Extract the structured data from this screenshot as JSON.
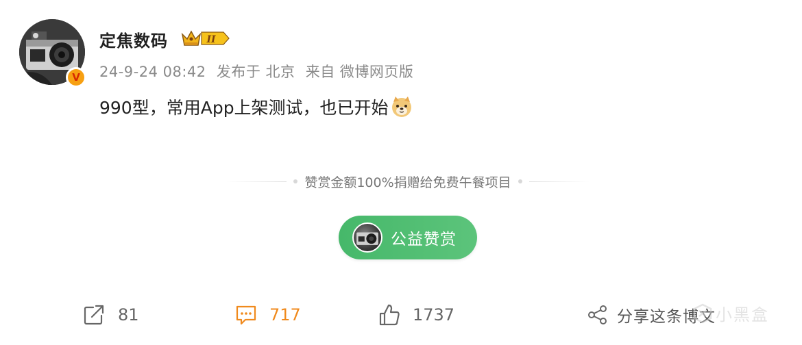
{
  "post": {
    "author": {
      "name": "定焦数码",
      "verified_badge": "V",
      "crown_level": "II"
    },
    "meta": {
      "timestamp": "24-9-24 08:42",
      "location": "发布于 北京",
      "source": "来自 微博网页版"
    },
    "content": {
      "text": "990型，常用App上架测试，也已开始",
      "emoji": "doge-emoji"
    }
  },
  "reward": {
    "notice": "赞赏金额100%捐赠给免费午餐项目",
    "button_label": "公益赞赏"
  },
  "actions": {
    "repost_count": "81",
    "comment_count": "717",
    "like_count": "1737",
    "share_label": "分享这条博文"
  },
  "watermark": {
    "text": "小黑盒"
  },
  "colors": {
    "accent_orange": "#f08a1d",
    "reward_green": "#4cbd70",
    "meta_gray": "#8a8a8a"
  }
}
